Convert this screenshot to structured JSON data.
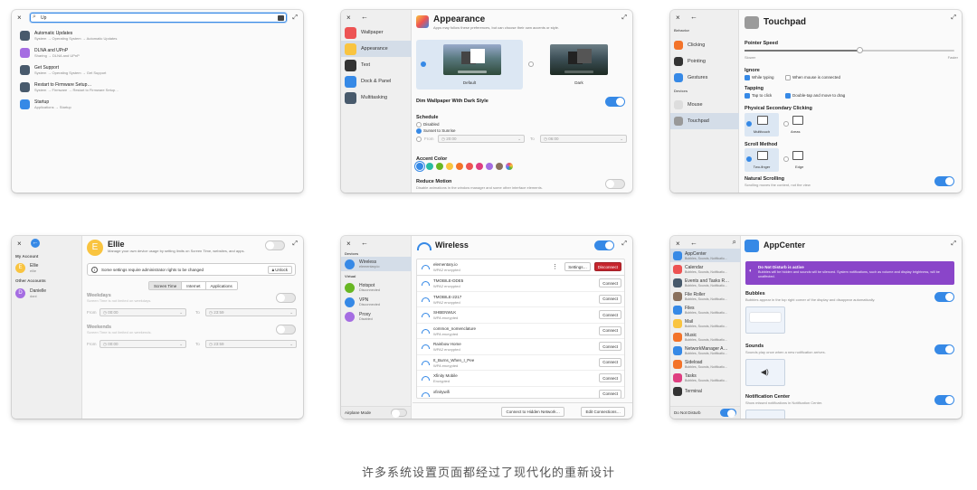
{
  "caption": "许多系统设置页面都经过了现代化的重新设计",
  "search": {
    "query": "Up",
    "results": [
      {
        "title": "Automatic Updates",
        "path": "System → Operating System → Automatic Updates",
        "color": "#485a6c"
      },
      {
        "title": "DLNA and UPnP",
        "path": "Sharing → DLNA and UPnP",
        "color": "#a56de2"
      },
      {
        "title": "Get Support",
        "path": "System → Operating System → Get Support",
        "color": "#485a6c"
      },
      {
        "title": "Restart to Firmware Setup…",
        "path": "System → Firmware → Restart to Firmware Setup…",
        "color": "#485a6c"
      },
      {
        "title": "Startup",
        "path": "Applications → Startup",
        "color": "#3689e6"
      }
    ]
  },
  "desktop": {
    "sidebar": [
      {
        "label": "Wallpaper",
        "color": "#ed5353"
      },
      {
        "label": "Appearance",
        "color": "#f9c440"
      },
      {
        "label": "Text",
        "color": "#333333"
      },
      {
        "label": "Dock & Panel",
        "color": "#3689e6"
      },
      {
        "label": "Multitasking",
        "color": "#485a6c"
      }
    ],
    "title": "Appearance",
    "subtitle": "Apps may follow these preferences, but can choose their own accents or style.",
    "style_default": "Default",
    "style_dark": "Dark",
    "dim_label": "Dim Wallpaper With Dark Style",
    "schedule_label": "Schedule",
    "schedule_options": [
      "Disabled",
      "Sunset to Sunrise",
      "Manual"
    ],
    "from_label": "From",
    "from_value": "20:00",
    "to_label": "To",
    "to_value": "06:00",
    "accent_label": "Accent Color",
    "accent_colors": [
      "#3689e6",
      "#28bca3",
      "#68b723",
      "#f9c440",
      "#f37329",
      "#ed5353",
      "#de3e80",
      "#a56de2",
      "#8a715e",
      "#667885"
    ],
    "motion_label": "Reduce Motion",
    "motion_desc": "Disable animations in the window manager and some other interface elements."
  },
  "touchpad": {
    "section_behavior": "Behavior",
    "section_devices": "Devices",
    "sidebar": [
      {
        "label": "Clicking",
        "color": "#f37329"
      },
      {
        "label": "Pointing",
        "color": "#333333"
      },
      {
        "label": "Gestures",
        "color": "#3689e6"
      }
    ],
    "devices": [
      {
        "label": "Mouse",
        "color": "#dddddd"
      },
      {
        "label": "Touchpad",
        "color": "#999999"
      }
    ],
    "title": "Touchpad",
    "speed_label": "Pointer Speed",
    "slower": "Slower",
    "faster": "Faster",
    "speed_level": 0.55,
    "ignore_label": "Ignore",
    "while_typing": "While typing",
    "mouse_connected": "When mouse is connected",
    "tapping_label": "Tapping",
    "tap_click": "Tap to click",
    "double_tap": "Double-tap and move to drag",
    "secondary_label": "Physical Secondary Clicking",
    "multitouch": "Multitouch",
    "areas": "Areas",
    "scroll_label": "Scroll Method",
    "two_finger": "Two-finger",
    "edge": "Edge",
    "natural_label": "Natural Scrolling",
    "natural_desc": "Scrolling moves the content, not the view"
  },
  "users": {
    "my_account": "My Account",
    "other_accounts": "Other Accounts",
    "accounts": [
      {
        "initial": "E",
        "name": "Ellie",
        "sub": "ellie",
        "color": "#f9c440"
      },
      {
        "initial": "D",
        "name": "Danielle",
        "sub": "dani",
        "color": "#a56de2"
      }
    ],
    "title": "Ellie",
    "subtitle": "Manage your own device usage by setting limits on Screen Time, websites, and apps.",
    "notice": "Some settings require administrator rights to be changed",
    "unlock": "Unlock",
    "tabs": [
      "Screen Time",
      "Internet",
      "Applications"
    ],
    "weekdays": "Weekdays",
    "weekdays_desc": "Screen Time is not limited on weekdays.",
    "weekends": "Weekends",
    "weekends_desc": "Screen Time is not limited on weekends.",
    "from_label": "From",
    "from_value": "00:00",
    "to_label": "To",
    "to_value": "23:59"
  },
  "network": {
    "section_devices": "Devices",
    "section_virtual": "Virtual",
    "sidebar": [
      {
        "label": "Wireless",
        "sub": "elementary.io",
        "color": "#3689e6"
      },
      {
        "label": "Hotspot",
        "sub": "Disconnected",
        "color": "#68b723"
      },
      {
        "label": "VPN",
        "sub": "Disconnected",
        "color": "#3689e6"
      },
      {
        "label": "Proxy",
        "sub": "Disabled",
        "color": "#a56de2"
      }
    ],
    "airplane": "Airplane Mode",
    "title": "Wireless",
    "connected": {
      "name": "elementary.io",
      "sub": "WPA2 encrypted"
    },
    "settings": "Settings…",
    "disconnect": "Disconnect",
    "networks": [
      {
        "name": "TMOBILE-DDE5",
        "sub": "WPA2 encrypted"
      },
      {
        "name": "TMOBILE-2217",
        "sub": "WPA2 encrypted"
      },
      {
        "name": "SHBENWLK",
        "sub": "WPA encrypted"
      },
      {
        "name": "common_nomenclature",
        "sub": "WPA encrypted"
      },
      {
        "name": "Rainbow Home",
        "sub": "WPA2 encrypted"
      },
      {
        "name": "It_Burns_When_I_Pee",
        "sub": "WPA encrypted"
      },
      {
        "name": "Xfinity Mobile",
        "sub": "Encrypted"
      },
      {
        "name": "xfinitywifi",
        "sub": ""
      }
    ],
    "connect": "Connect",
    "hidden": "Connect to Hidden Network…",
    "edit": "Edit Connections…"
  },
  "notifications": {
    "apps": [
      {
        "label": "AppCenter",
        "sub": "Bubbles, Sounds, Notificatio…",
        "color": "#3689e6"
      },
      {
        "label": "Calendar",
        "sub": "Bubbles, Sounds, Notificatio…",
        "color": "#ed5353"
      },
      {
        "label": "Events and Tasks R…",
        "sub": "Bubbles, Sounds, Notificatio…",
        "color": "#485a6c"
      },
      {
        "label": "File Roller",
        "sub": "Bubbles, Sounds, Notificatio…",
        "color": "#8a715e"
      },
      {
        "label": "Files",
        "sub": "Bubbles, Sounds, Notificatio…",
        "color": "#3689e6"
      },
      {
        "label": "Mail",
        "sub": "Bubbles, Sounds, Notificatio…",
        "color": "#f9c440"
      },
      {
        "label": "Music",
        "sub": "Bubbles, Sounds, Notificatio…",
        "color": "#f37329"
      },
      {
        "label": "NetworkManager A…",
        "sub": "Bubbles, Sounds, Notificatio…",
        "color": "#3689e6"
      },
      {
        "label": "Sideload",
        "sub": "Bubbles, Sounds, Notificatio…",
        "color": "#f37329"
      },
      {
        "label": "Tasks",
        "sub": "Bubbles, Sounds, Notificatio…",
        "color": "#de3e80"
      },
      {
        "label": "Terminal",
        "sub": "",
        "color": "#333333"
      }
    ],
    "dnd": "Do Not Disturb",
    "title": "AppCenter",
    "banner_title": "Do Not Disturb is active",
    "banner_desc": "Bubbles will be hidden and sounds will be silenced. System notifications, such as volume and display brightness, will be unaffected.",
    "bubbles": "Bubbles",
    "bubbles_desc": "Bubbles appear in the top right corner of the display and disappear automatically.",
    "sounds": "Sounds",
    "sounds_desc": "Sounds play once when a new notification arrives.",
    "center": "Notification Center",
    "center_desc": "Show missed notifications in Notification Center."
  }
}
